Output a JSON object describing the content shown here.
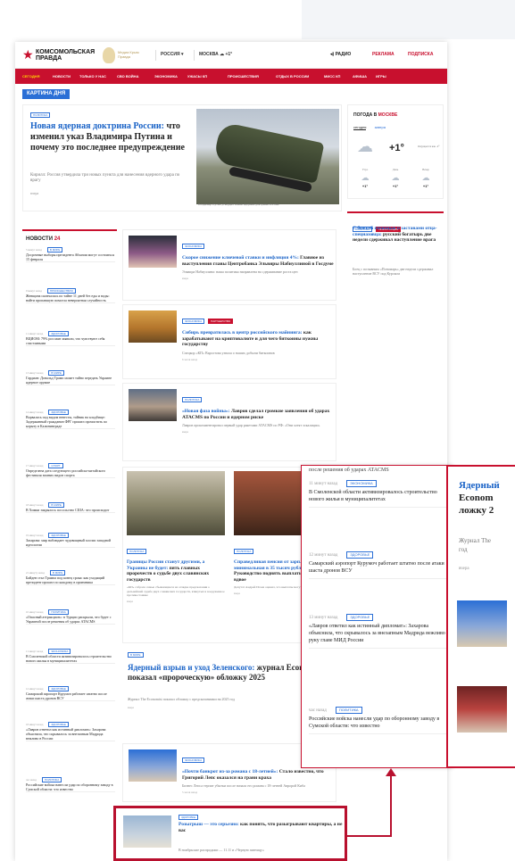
{
  "site": {
    "logo_text": "КОМСОМОЛЬСКАЯ ПРАВДА",
    "badge_text": "Медиа Крым Правда",
    "region": "РОССИЯ",
    "city": "МОСКВА",
    "city_temp": "+1°",
    "radio": "РАДИО",
    "ads": "РЕКЛАМА",
    "subscribe": "ПОДПИСКА"
  },
  "nav": [
    "СЕГОДНЯ",
    "НОВОСТИ",
    "ТОЛЬКО У НАС",
    "СВО ВОЙНА",
    "ЭКОНОМИКА",
    "УЖАСЫ КП",
    "ПРОИСШЕСТВИЯ",
    "ОТДЫХ В РОССИИ",
    "МИСС КП",
    "АФИША",
    "ИГРЫ"
  ],
  "picture_of_day": "КАРТИНА ДНЯ",
  "hero": {
    "rubric": "ПОЛИТИКА",
    "title_blue": "Новая ядерная доктрина России:",
    "title_black": "что изменил указ Владимира Путина и почему это последнее предупреждение",
    "lead": "Кирилл: Россия утвердила три новых пункта для нанесения ядерного удара по врагу",
    "time": "вчера",
    "caption": "Владимир Путин утвердил новые ядерные доктрины России."
  },
  "weather": {
    "title": "ПОГОДА В",
    "city": "МОСКВЕ",
    "tab_today": "сегодня",
    "tab_tomorrow": "завтра",
    "temp": "+1°",
    "desc": "Ощущается как -2°",
    "parts": [
      {
        "label": "Утро",
        "temp": "+1°"
      },
      {
        "label": "День",
        "temp": "+1°"
      },
      {
        "label": "Вечер",
        "temp": "+1°"
      }
    ]
  },
  "promo": {
    "rubrics": [
      "ПОЛИТИКА",
      "ИНФОРМАЦИЯ"
    ],
    "title_blue": "С божьей помощью и заставами отца-спецназовца:",
    "title_black": "русский богатырь две недели сдерживал наступление врага",
    "lead": "Боец с позывным «Пономарь» две недели сдерживал наступление ВСУ под Курском"
  },
  "news": {
    "title": "НОВОСТИ",
    "count": "24",
    "items": [
      {
        "meta": "5 минут назад",
        "rubric": "В МИРЕ",
        "text": "Досрочные выборы президента Абхазии могут состояться 15 февраля"
      },
      {
        "meta": "9 минут назад",
        "rubric": "ПРОИСШЕСТВИЯ",
        "text": "Женщина скончалась по тайне 11 дней без еды и воды: найти пропавшую помогла невероятная случайность"
      },
      {
        "meta": "11 минут назад",
        "rubric": "ЗДОРОВЬЕ",
        "text": "ВЦИОМ: 79% россиян заявили, что чувствуют себя счастливыми"
      },
      {
        "meta": "13 минут назад",
        "rubric": "В МИРЕ",
        "text": "Гардиан: Дональд Трамп может тайно передать Украине ядерное оружие"
      },
      {
        "meta": "14 минут назад",
        "rubric": "ЗДОРОВЬЕ",
        "text": "Ворвалась под видом невесты, тайник на кладбище: Задержанный гражданин ФРГ пришел прочистить по корыту в Калининграде"
      },
      {
        "meta": "17 минут назад",
        "rubric": "СПОРТ",
        "text": "Определена дата следующего российско-китайского фестиваля зимних видов спорта"
      },
      {
        "meta": "18 минут назад",
        "rubric": "В МИРЕ",
        "text": "В Химки закрылось посольство США: что происходит"
      },
      {
        "meta": "19 минут назад",
        "rubric": "ЗДОРОВЬЕ",
        "text": "Захарова: мир наблюдает чудовищный хоспис западной идеологии"
      },
      {
        "meta": "21 минуту назад",
        "rubric": "В МИРЕ",
        "text": "Байден стал Трампа под конец срока: как уходящий президент прошел по каждому в приемника"
      },
      {
        "meta": "10 минут назад",
        "rubric": "ПОЛИТИКА",
        "text": "«Опасный аттракцион»: в Турции раскрыли, что будет с Украиной после решения об ударах ATACMS"
      },
      {
        "meta": "11 минут назад",
        "rubric": "ЭКОНОМИКА",
        "text": "В Смоленской области активизировалось строительство нового жилья в муниципалитетах"
      },
      {
        "meta": "12 минут назад",
        "rubric": "ЗДОРОВЬЕ",
        "text": "Самарский аэропорт Курумоч работает штатно после атаки шаста дронов ВСУ"
      },
      {
        "meta": "18 минут назад",
        "rubric": "ЗДОРОВЬЕ",
        "text": "«Лавров ответил как истинный дипломат»: Захарова объяснила, что скрывалось за внезапным Мадрида вежливо в России"
      },
      {
        "meta": "час назад",
        "rubric": "ПОЛИТИКА",
        "text": "Российские войска нанесли удар по оборонному заводу в Сумской области: что известно"
      }
    ]
  },
  "cards": [
    {
      "rubric": "ЭКОНОМИКА",
      "title_blue": "Скорое снижение ключевой ставки и инфляция 4%:",
      "title_black": "Главное из выступления главы Центробанка Эльвиры Набиуллиной в Госдуме",
      "lead": "Эльвира Набиуллина: наша политика направлена на сдерживание роста цен",
      "time": "вчера"
    },
    {
      "rubric": "ЭКОНОМИКА",
      "rubric2": "ПАРТНЕРСТВО",
      "title_blue": "Сибирь превратилась в центр российского майнинга:",
      "title_black": "как зарабатывают на криптовалюте и для чего биткоины нужны государству",
      "lead": "Спецкор «КП» Варсотова узнала о наших добычи биткоинов",
      "time": "6 часов назад"
    },
    {
      "rubric": "ПОЛИТИКА",
      "title_blue": "«Новая фаза войны»:",
      "title_black": "Лавров сделал громкие заявления об ударах ATACMS по России и ядерном риске",
      "lead": "Лавров прокомментировал первый удар ракетами ATACMS по РФ: «Они хотят эскалации»",
      "time": "вчера"
    }
  ],
  "big2": [
    {
      "rubric": "ПОЛИТИКА",
      "title_blue": "Границы России станут другими, а Украины не будет:",
      "title_black": "пять главных пророчеств о судьбе двух славянских государств",
      "lead": "«КП» собрала самые сбывающиеся на оглядке предсказания о дальнейшей судьбе двух славянских государств, втянутых в вооруженное противостояние",
      "time": "вчера"
    },
    {
      "rubric": "ПОЛИТИКА",
      "title_blue": "Справедливая пенсия от зарплаты, а минимальная в 35 тысяч рублей:",
      "title_black": "Руководство поднять выплаты чуть ли не вдвое",
      "lead": "Депутат Андрей Исаев оценил, что выплаты могут пустить госприоритеты",
      "time": "вчера"
    }
  ],
  "feature": {
    "rubric": "В МИРЕ",
    "title_blue": "Ядерный взрыв и уход Зеленского:",
    "title_black": "журнал Economist показал «пророческую» обложку 2025",
    "lead": "Журнал The Economist показал обложку с предсказаниями на 2025 год",
    "time": "вчера"
  },
  "card4": {
    "rubric": "ЭКОНОМИКА",
    "title_blue": "«Почти банкрот из-за романа с 18-летней»:",
    "title_black": "Стало известно, что Григорий Лепс оказался на грани краха",
    "lead": "Бизнес Лепса терпит убытки после начала его романа с 18-летней Авророй Киба",
    "time": "5 часов назад"
  },
  "highlight": {
    "rubric": "ЗДОРОВЬЕ",
    "title_blue": "Розыгрыш — это серьезно:",
    "title_black": "как понять, что разыгрывают квартиры, а не вас",
    "lead": "В ноябрьские распродажи — 11.11 и «Черную пятницу»"
  },
  "zoom": {
    "head": "после решения об ударах ATACMS",
    "items": [
      {
        "meta": "11 минут назад",
        "rubric": "ЭКОНОМИКА",
        "text": "В Смоленской области активизировалось строительство нового жилья в муниципалитетах"
      },
      {
        "meta": "12 минут назад",
        "rubric": "ЗДОРОВЬЕ",
        "text": "Самарский аэропорт Курумоч работает штатно после атаки шаста дронов ВСУ"
      },
      {
        "meta": "13 минут назад",
        "rubric": "ЗДОРОВЬЕ",
        "text": "«Лавров ответил как истинный дипломат»: Захарова объяснила, что скрывалось за внезапным Мадрида вежливо руку главе МИД России"
      },
      {
        "meta": "час назад",
        "rubric": "ПОЛИТИКА",
        "text": "Российские войска нанесли удар по оборонному заводу в Сумской области: что известно"
      }
    ]
  },
  "zoom2": {
    "title_blue": "Ядерный",
    "title_black_1": "Econom",
    "title_black_2": "ложку 2",
    "lead_1": "Журнал The",
    "lead_2": "год",
    "time": "вчера"
  }
}
